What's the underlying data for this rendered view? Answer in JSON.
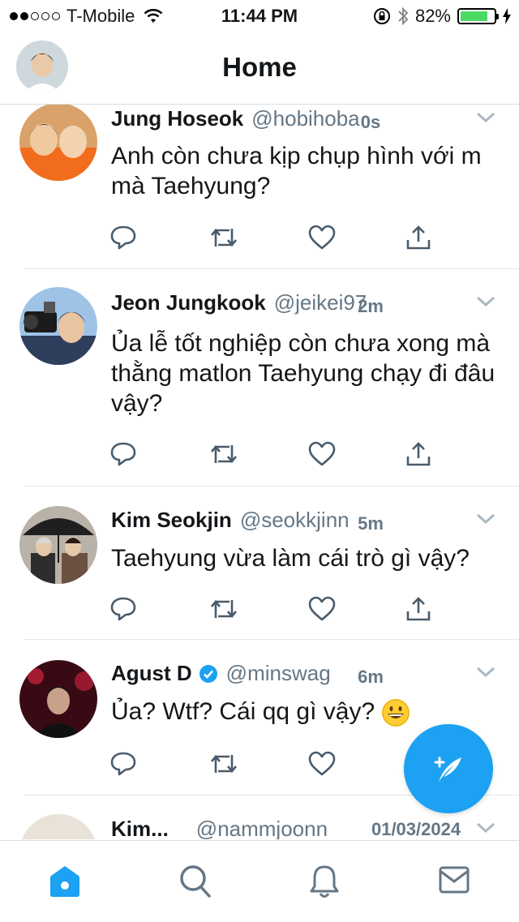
{
  "status_bar": {
    "carrier": "T-Mobile",
    "time": "11:44 PM",
    "battery": "82%",
    "battery_level": 0.82,
    "signal_bars": 2
  },
  "nav": {
    "title": "Home"
  },
  "tweets": [
    {
      "name": "Jung Hoseok",
      "handle": "@hobihoba",
      "time": "0s",
      "text": "Anh còn chưa kịp chụp hình với m mà Taehyung?"
    },
    {
      "name": "Jeon Jungkook",
      "handle": "@jeikei97",
      "time": "2m",
      "text": "Ủa lễ tốt nghiệp còn chưa xong mà thằng matlon Taehyung chạy đi đâu vậy?"
    },
    {
      "name": "Kim Seokjin",
      "handle": "@seokkjinn",
      "time": "5m",
      "text": "Taehyung vừa làm cái trò gì vậy?"
    },
    {
      "name": "Agust D",
      "handle": "@minswag",
      "time": "6m",
      "verified": true,
      "text": "Ủa? Wtf? Cái qq gì vậy?"
    },
    {
      "name": "Kim...",
      "handle": "@nammjoonn",
      "time": "01/03/2024",
      "text": ""
    }
  ],
  "colors": {
    "accent": "#1da1f2",
    "muted": "#657786",
    "icon": "#4a5b6b"
  },
  "icons": {
    "reply": "reply-icon",
    "retweet": "retweet-icon",
    "like": "heart-icon",
    "share": "share-icon",
    "compose": "compose-feather-icon",
    "home": "home-icon",
    "search": "search-icon",
    "notifications": "bell-icon",
    "messages": "mail-icon"
  }
}
